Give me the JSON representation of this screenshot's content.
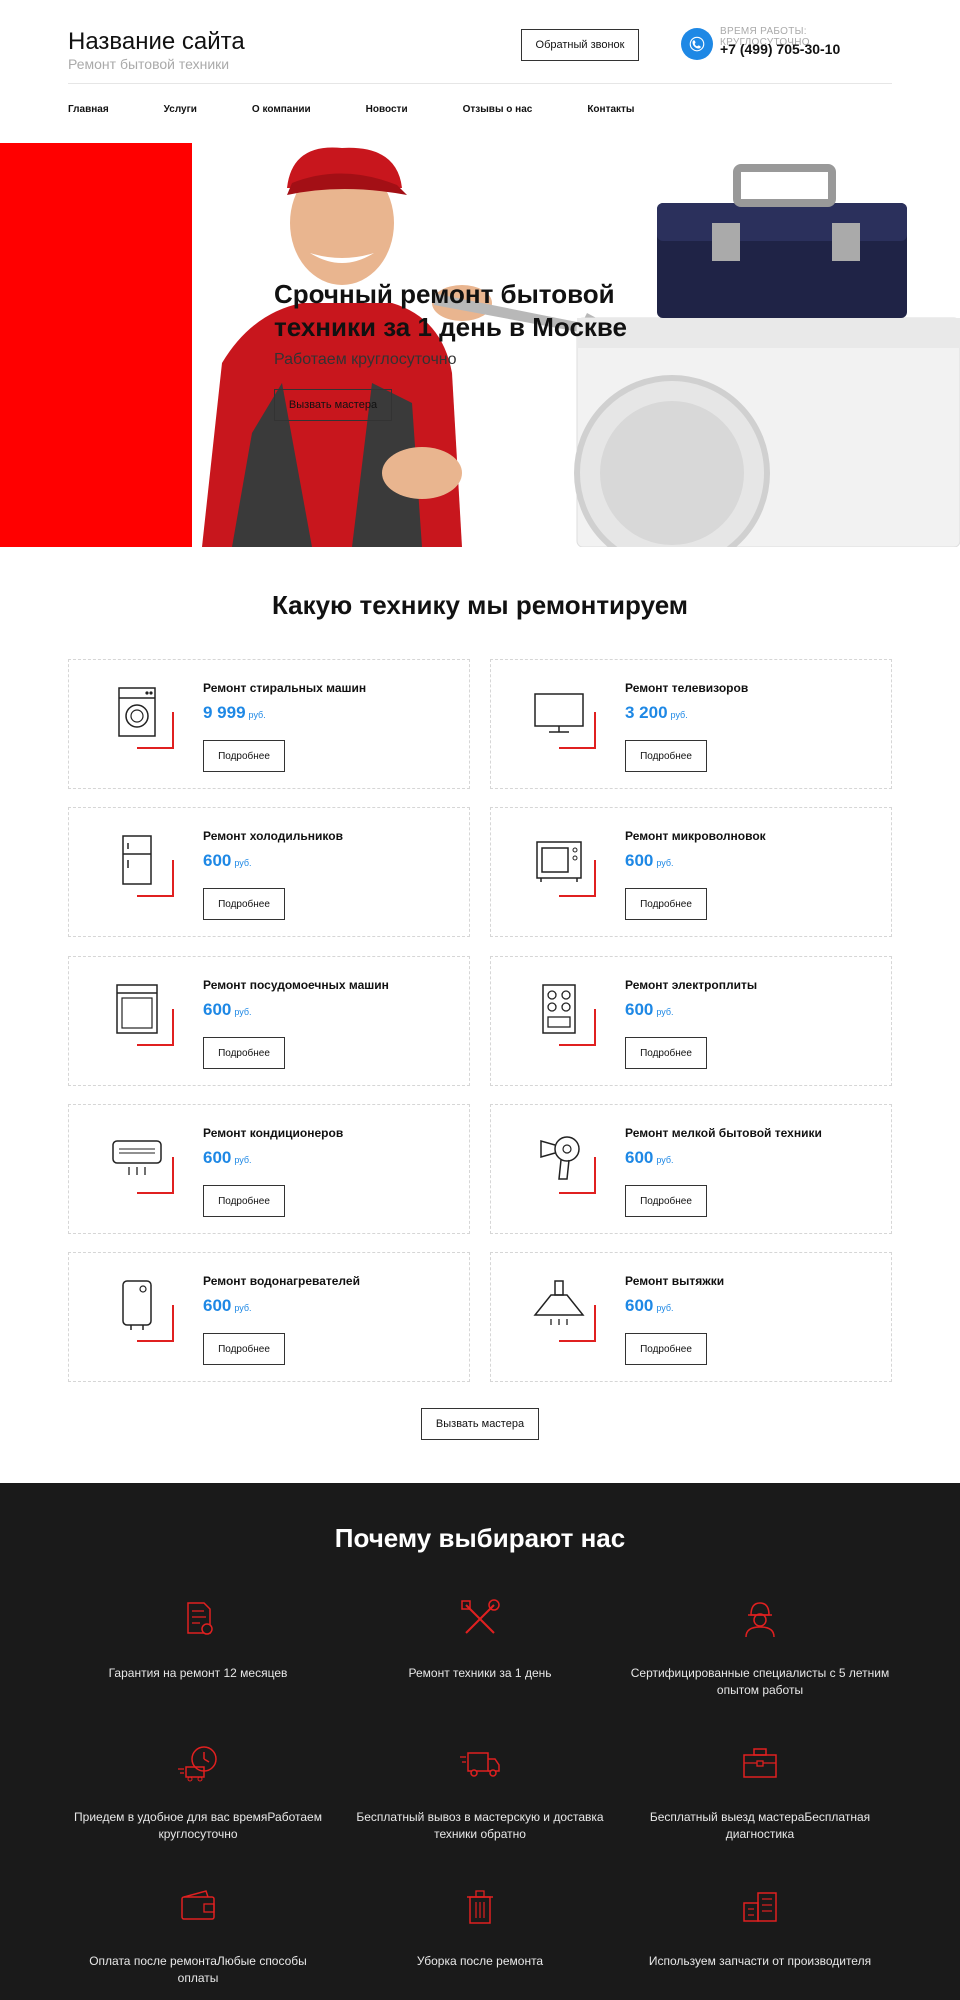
{
  "header": {
    "site_title": "Название сайта",
    "site_subtitle": "Ремонт бытовой техники",
    "callback_label": "Обратный звонок",
    "work_hours": "ВРЕМЯ РАБОТЫ: КРУГЛОСУТОЧНО",
    "phone": "+7 (499) 705-30-10",
    "phone_icon": "phone-icon"
  },
  "nav": {
    "items": [
      "Главная",
      "Услуги",
      "О компании",
      "Новости",
      "Отзывы о нас",
      "Контакты"
    ]
  },
  "hero": {
    "title": "Срочный ремонт бытовой техники за 1 день в Москве",
    "subtitle": "Работаем круглосуточно",
    "button_label": "Вызвать мастера",
    "accent_color": "#ff0000"
  },
  "services": {
    "title": "Какую технику мы ремонтируем",
    "button_label": "Подробнее",
    "currency": "руб.",
    "price_color": "#1e88e5",
    "cards": [
      {
        "title": "Ремонт стиральных машин",
        "price": "9 999",
        "icon": "washing-machine-icon"
      },
      {
        "title": "Ремонт телевизоров",
        "price": "3 200",
        "icon": "tv-icon"
      },
      {
        "title": "Ремонт холодильников",
        "price": "600",
        "icon": "fridge-icon"
      },
      {
        "title": "Ремонт микроволновок",
        "price": "600",
        "icon": "microwave-icon"
      },
      {
        "title": "Ремонт посудомоечных машин",
        "price": "600",
        "icon": "dishwasher-icon"
      },
      {
        "title": "Ремонт электроплиты",
        "price": "600",
        "icon": "stove-icon"
      },
      {
        "title": "Ремонт кондиционеров",
        "price": "600",
        "icon": "air-conditioner-icon"
      },
      {
        "title": "Ремонт мелкой бытовой техники",
        "price": "600",
        "icon": "hair-dryer-icon"
      },
      {
        "title": "Ремонт водонагревателей",
        "price": "600",
        "icon": "water-heater-icon"
      },
      {
        "title": "Ремонт вытяжки",
        "price": "600",
        "icon": "cooker-hood-icon"
      }
    ],
    "call_master_label": "Вызвать мастера"
  },
  "why": {
    "title": "Почему выбирают нас",
    "icon_color": "#e02020",
    "features": [
      {
        "text": "Гарантия на ремонт 12 месяцев",
        "icon": "warranty-document-icon"
      },
      {
        "text": "Ремонт техники за 1 день",
        "icon": "tools-icon"
      },
      {
        "text": "Сертифицированные специалисты с 5 летним опытом работы",
        "icon": "worker-icon"
      },
      {
        "text": "Приедем в удобное для вас времяРаботаем круглосуточно",
        "icon": "fast-delivery-clock-icon"
      },
      {
        "text": "Бесплатный вывоз в мастерскую и доставка техники обратно",
        "icon": "truck-icon"
      },
      {
        "text": "Бесплатный выезд мастераБесплатная диагностика",
        "icon": "toolbox-icon"
      },
      {
        "text": "Оплата после ремонтаЛюбые способы оплаты",
        "icon": "wallet-icon"
      },
      {
        "text": "Уборка после ремонта",
        "icon": "trash-bin-icon"
      },
      {
        "text": "Используем запчасти от производителя",
        "icon": "factory-icon"
      }
    ]
  }
}
